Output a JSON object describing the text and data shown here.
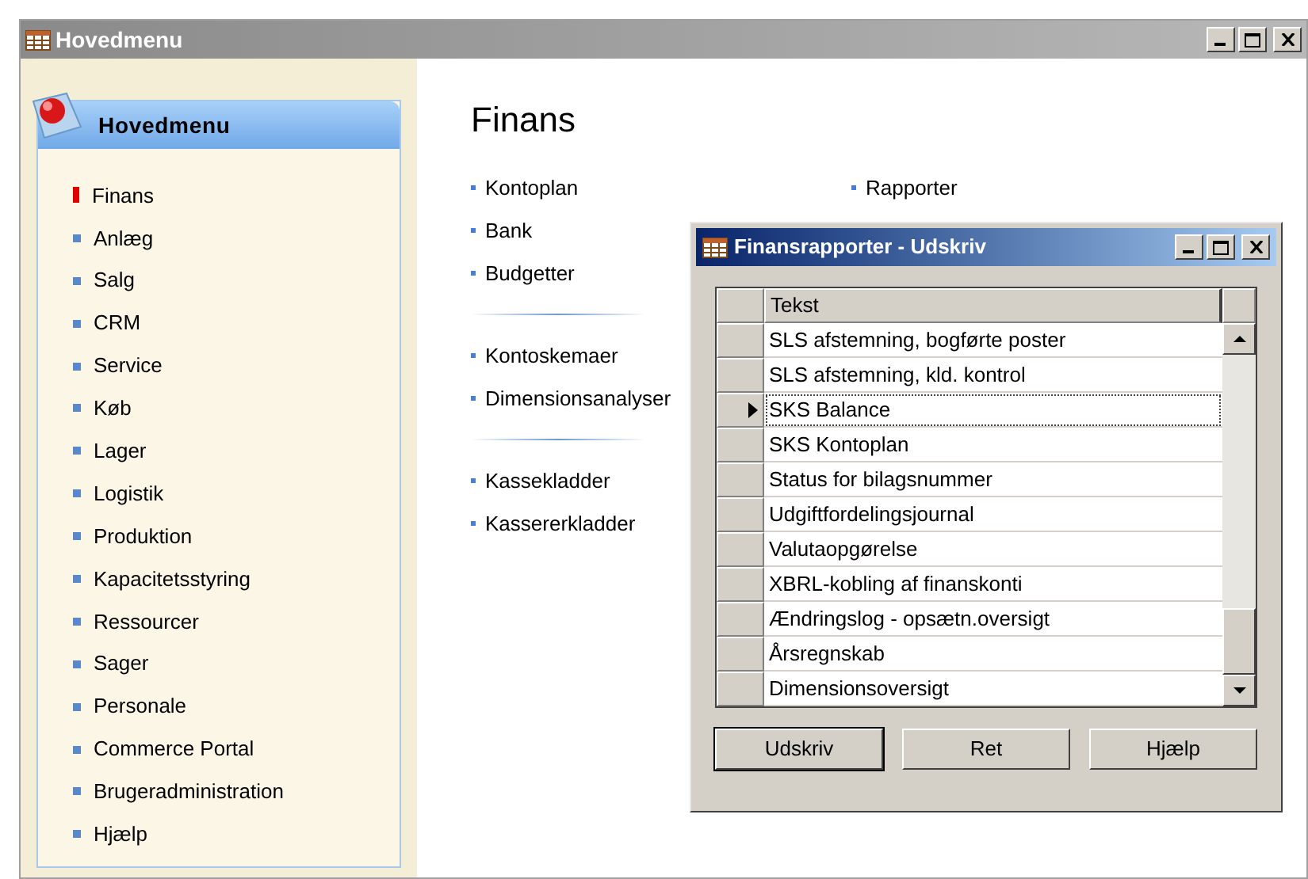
{
  "window": {
    "title": "Hovedmenu"
  },
  "sidebar": {
    "title": "Hovedmenu",
    "items": [
      {
        "label": "Finans",
        "selected": true
      },
      {
        "label": "Anlæg",
        "selected": false
      },
      {
        "label": "Salg",
        "selected": false
      },
      {
        "label": "CRM",
        "selected": false
      },
      {
        "label": "Service",
        "selected": false
      },
      {
        "label": "Køb",
        "selected": false
      },
      {
        "label": "Lager",
        "selected": false
      },
      {
        "label": "Logistik",
        "selected": false
      },
      {
        "label": "Produktion",
        "selected": false
      },
      {
        "label": "Kapacitetsstyring",
        "selected": false
      },
      {
        "label": "Ressourcer",
        "selected": false
      },
      {
        "label": "Sager",
        "selected": false
      },
      {
        "label": "Personale",
        "selected": false
      },
      {
        "label": "Commerce Portal",
        "selected": false
      },
      {
        "label": "Brugeradministration",
        "selected": false
      },
      {
        "label": "Hjælp",
        "selected": false
      }
    ]
  },
  "content": {
    "heading": "Finans",
    "columns": [
      {
        "groups": [
          {
            "links": [
              "Kontoplan",
              "Bank",
              "Budgetter"
            ]
          },
          {
            "links": [
              "Kontoskemaer",
              "Dimensionsanalyser"
            ]
          },
          {
            "links": [
              "Kassekladder",
              "Kassererkladder"
            ]
          }
        ]
      },
      {
        "groups": [
          {
            "links": [
              "Rapporter"
            ]
          }
        ]
      }
    ]
  },
  "dialog": {
    "title": "Finansrapporter - Udskriv",
    "table": {
      "columns": [
        "Tekst"
      ],
      "rows": [
        {
          "text": "SLS afstemning, bogførte poster",
          "selected": false
        },
        {
          "text": "SLS afstemning, kld. kontrol",
          "selected": false
        },
        {
          "text": "SKS Balance",
          "selected": true
        },
        {
          "text": "SKS Kontoplan",
          "selected": false
        },
        {
          "text": "Status for bilagsnummer",
          "selected": false
        },
        {
          "text": "Udgiftfordelingsjournal",
          "selected": false
        },
        {
          "text": "Valutaopgørelse",
          "selected": false
        },
        {
          "text": "XBRL-kobling af finanskonti",
          "selected": false
        },
        {
          "text": "Ændringslog - opsætn.oversigt",
          "selected": false
        },
        {
          "text": "Årsregnskab",
          "selected": false
        },
        {
          "text": "Dimensionsoversigt",
          "selected": false
        }
      ]
    },
    "buttons": [
      {
        "label": "Udskriv",
        "default": true
      },
      {
        "label": "Ret",
        "default": false
      },
      {
        "label": "Hjælp",
        "default": false
      }
    ]
  }
}
